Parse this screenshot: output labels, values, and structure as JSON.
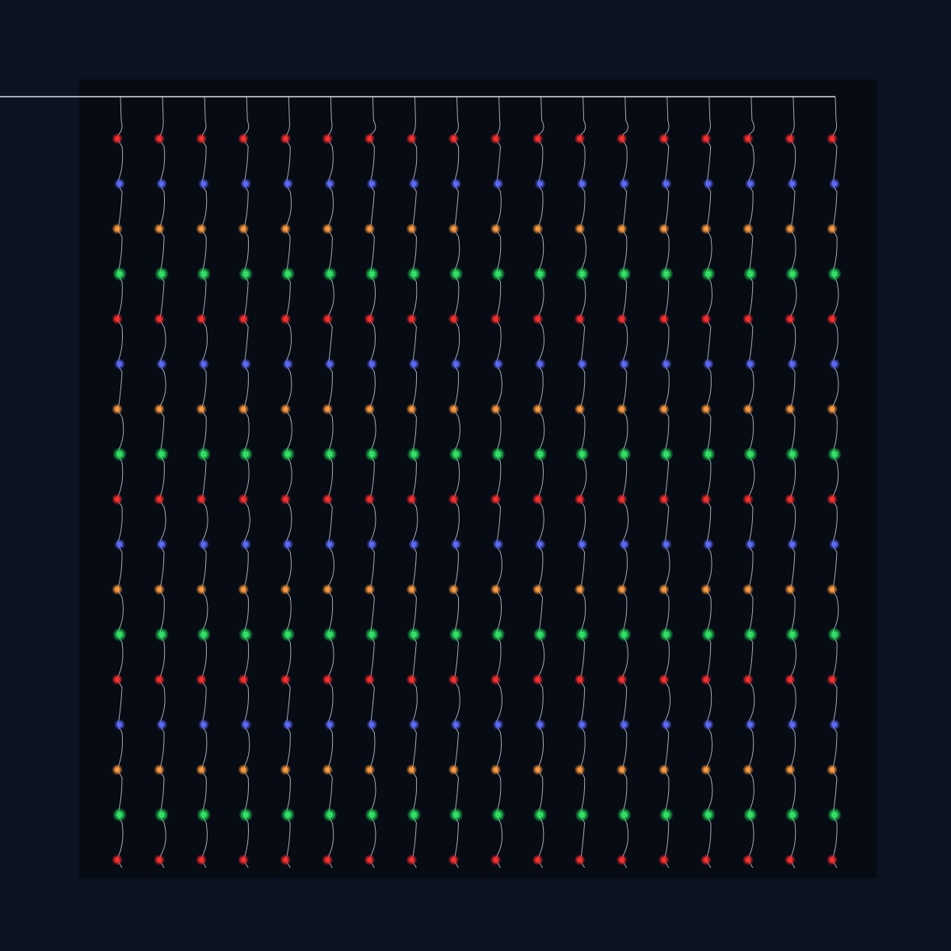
{
  "scene": {
    "subject": "light-curtain",
    "strand_count": 18,
    "bulbs_per_strand": 17,
    "bulb_color_cycle": [
      "red",
      "blue",
      "amber",
      "green"
    ],
    "colors": {
      "background": "#0b1220",
      "backdrop": "#070b14",
      "wire": "#d9dde3",
      "red": "#ff2a2a",
      "blue": "#5a66ff",
      "amber": "#ff9a3c",
      "green": "#22e05a"
    }
  }
}
